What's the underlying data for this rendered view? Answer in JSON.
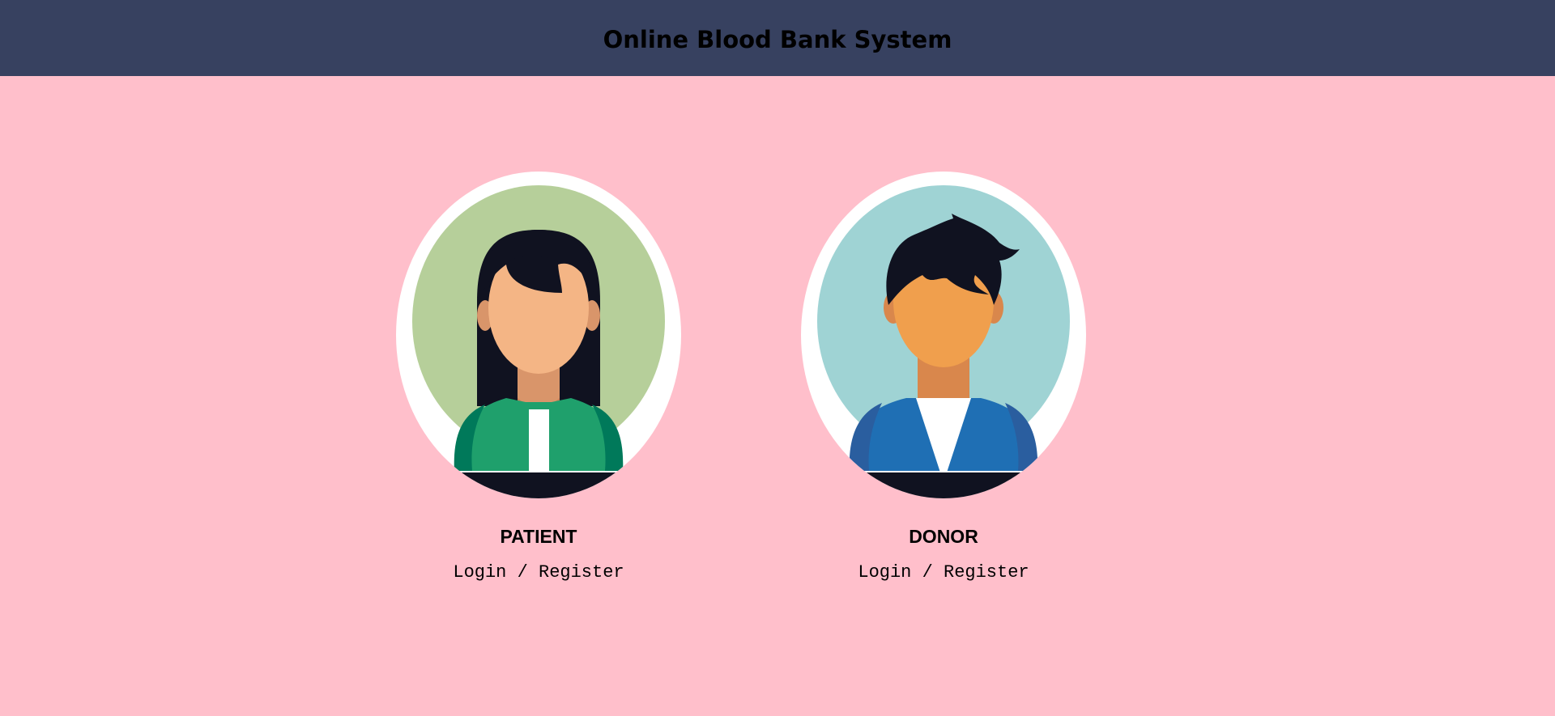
{
  "header": {
    "title": "Online Blood Bank System",
    "bg_color": "#374160"
  },
  "page": {
    "bg_color": "#ffbfcb"
  },
  "cards": [
    {
      "role": "PATIENT",
      "action": "Login / Register",
      "avatar_icon": "female-avatar-icon",
      "ring_color": "#b6cf9a",
      "shirt_color": "#1fa06c"
    },
    {
      "role": "DONOR",
      "action": "Login / Register",
      "avatar_icon": "male-avatar-icon",
      "ring_color": "#9fd3d4",
      "shirt_color": "#1f6fb4"
    }
  ]
}
